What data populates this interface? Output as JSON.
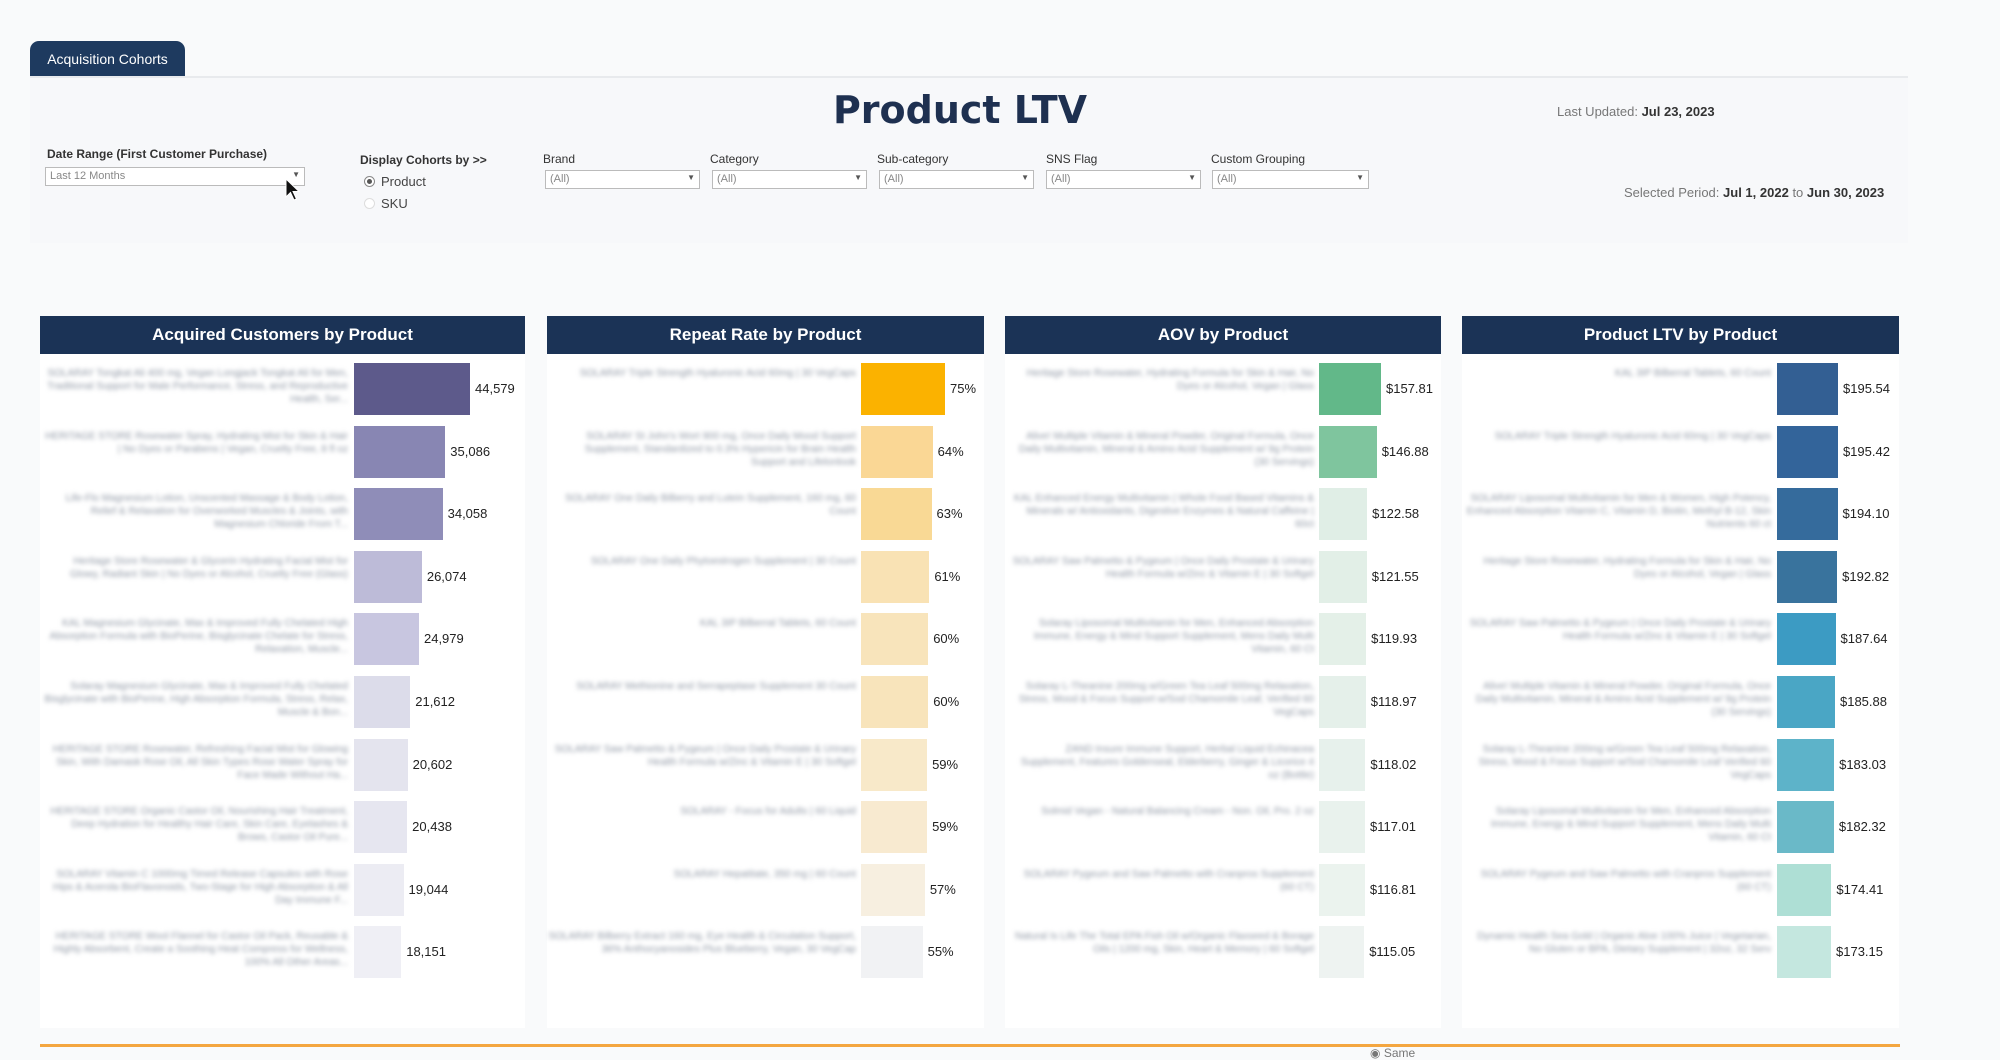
{
  "tab": {
    "label": "Acquisition Cohorts"
  },
  "header": {
    "title": "Product LTV",
    "last_updated_label": "Last Updated:",
    "last_updated_value": "Jul 23, 2023",
    "selected_period_label": "Selected Period:",
    "selected_period_start": "Jul 1, 2022",
    "selected_period_to": "to",
    "selected_period_end": "Jun 30, 2023"
  },
  "filters": {
    "date_range": {
      "label": "Date Range (First Customer Purchase)",
      "value": "Last 12 Months"
    },
    "display_cohorts": {
      "label": "Display Cohorts by >>",
      "options": [
        "Product",
        "SKU"
      ],
      "selected": "Product"
    },
    "brand": {
      "label": "Brand",
      "value": "(All)"
    },
    "category": {
      "label": "Category",
      "value": "(All)"
    },
    "subcategory": {
      "label": "Sub-category",
      "value": "(All)"
    },
    "sns_flag": {
      "label": "SNS Flag",
      "value": "(All)"
    },
    "custom_grouping": {
      "label": "Custom Grouping",
      "value": "(All)"
    }
  },
  "footer": {
    "same_label": "Same"
  },
  "chart_data": [
    {
      "type": "bar",
      "title": "Acquired Customers by Product",
      "categories": [
        "SOLARAY Tongkat Ali 400 mg, Vegan Longjack Tongkat Ali for Men, Traditional Support for Male Performance, Stress, and Reproductive Health, Ser...",
        "HERITAGE STORE Rosewater Spray, Hydrating Mist for Skin & Hair | No Dyes or Parabens | Vegan, Cruelty Free, 8 fl oz",
        "Life-Flo Magnesium Lotion, Unscented Massage & Body Lotion, Relief & Relaxation for Overworked Muscles & Joints, with Magnesium Chloride From T...",
        "Heritage Store Rosewater & Glycerin Hydrating Facial Mist for Glowy, Radiant Skin | No Dyes or Alcohol, Cruelty Free (Glass)",
        "KAL Magnesium Glycinate, Max & Improved Fully Chelated High Absorption Formula with BioPerine, Bisglycinate Chelate for Stress, Relaxation, Muscle...",
        "Solaray Magnesium Glycinate, Max & Improved Fully Chelated Bisglycinate with BioPerine, High Absorption Formula, Stress, Relax, Muscle & Bon...",
        "HERITAGE STORE Rosewater, Refreshing Facial Mist for Glowing Skin, With Damask Rose Oil, All Skin Types Rose Water Spray for Face Made Without Ha...",
        "HERITAGE STORE Organic Castor Oil, Nourishing Hair Treatment, Deep Hydration for Healthy Hair Care, Skin Care, Eyelashes & Brows, Castor Oil Pure...",
        "SOLARAY Vitamin C 1000mg Timed Release Capsules with Rose Hips & Acerola BioFlavonoids, Two-Stage for High Absorption & All Day Immune F...",
        "HERITAGE STORE Wool Flannel for Castor Oil Pack, Reusable & Highly Absorbent, Create a Soothing Heat Compress for Wellness, 100% All Other Areas..."
      ],
      "values": [
        44579,
        35086,
        34058,
        26074,
        24979,
        21612,
        20602,
        20438,
        19044,
        18151
      ],
      "labels": [
        "44,579",
        "35,086",
        "34,058",
        "26,074",
        "24,979",
        "21,612",
        "20,602",
        "20,438",
        "19,044",
        "18,151"
      ],
      "colors": [
        "#5d5a8b",
        "#8886b3",
        "#8f8db8",
        "#bdbbd8",
        "#c8c6e0",
        "#dcdcea",
        "#e4e4ee",
        "#e6e6f0",
        "#ececf3",
        "#efeff5"
      ],
      "xlim": [
        0,
        44579
      ]
    },
    {
      "type": "bar",
      "title": "Repeat Rate by Product",
      "categories": [
        "SOLARAY Triple Strength Hyaluronic Acid 60mg | 30 VegCaps",
        "SOLARAY St John's Wort 900 mg, Once Daily Mood Support Supplement, Standardized to 0.3% Hypericin for Brain Health Support and Lifelonlook",
        "SOLARAY One Daily Bilberry and Lutein Supplement, 160 mg, 60 Count",
        "SOLARAY One Daily Phytoestrogen Supplement | 30 Count",
        "KAL 3IP Bilberral Tablets, 60 Count",
        "SOLARAY Methionine and Serrapeptase Supplement 30 Count",
        "SOLARAY Saw Palmetto & Pygeum | Once Daily Prostate & Urinary Health Formula w/Zinc & Vitamin E | 30 Softgel",
        "SOLARAY - Focus for Adults | 60 Liquid",
        "SOLARAY Hepatitate, 350 mg | 60 Count",
        "SOLARAY Bilberry Extract 160 mg, Eye Health & Circulation Support, 36% Anthocyanosides Plus Blueberry, Vegan, 30 VegCap"
      ],
      "values": [
        75,
        64,
        63,
        61,
        60,
        60,
        59,
        59,
        57,
        55
      ],
      "labels": [
        "75%",
        "64%",
        "63%",
        "61%",
        "60%",
        "60%",
        "59%",
        "59%",
        "57%",
        "55%"
      ],
      "colors": [
        "#fbb200",
        "#fad795",
        "#f9d995",
        "#f9e2b4",
        "#f8e4bb",
        "#f8e4bb",
        "#f8e9c9",
        "#f8ead0",
        "#f7efe0",
        "#f1f2f4"
      ],
      "xlim": [
        0,
        75
      ]
    },
    {
      "type": "bar",
      "title": "AOV by Product",
      "categories": [
        "Heritage Store Rosewater, Hydrating Formula for Skin & Hair, No Dyes or Alcohol, Vegan | Glass",
        "Alive! Multiple Vitamin & Mineral Powder, Original Formula, Once Daily Multivitamin, Mineral & Amino Acid Supplement w/ 9g Protein (30 Servings)",
        "KAL Enhanced Energy Multivitamin | Whole Food Based Vitamins & Minerals w/ Antioxidants, Digestive Enzymes & Natural Caffeine | 60ct",
        "SOLARAY Saw Palmetto & Pygeum | Once Daily Prostate & Urinary Health Formula w/Zinc & Vitamin E | 30 Softgel",
        "Solaray Liposomal Multivitamin for Men, Enhanced Absorption Immune, Energy & Mind Support Supplement, Mens Daily Multi Vitamin, 60 Ct",
        "Solaray L-Theanine 200mg w/Green Tea Leaf 500mg Relaxation, Stress, Mood & Focus Support w/Sod Chamomile Leaf, Verified 60 VegCaps",
        "ZAND Insure Immune Support, Herbal Liquid Echinacea Supplement, Features Goldenseal, Elderberry, Ginger & Licorice 4 oz (Bottle)",
        "Solmid Vegan - Natural Balancing Cream - Non. Oil, Pro. 2 oz",
        "SOLARAY Pygeum and Saw Palmetto with Cranpros Supplement (60 CT)",
        "Natural Is Life The Total EPA Fish Oil w/Organic Flaxseed & Borage Oils | 1200 mg, Skin, Heart & Memory | 60 Softgel"
      ],
      "values": [
        157.81,
        146.88,
        122.58,
        121.55,
        119.93,
        118.97,
        118.02,
        117.01,
        116.81,
        115.05
      ],
      "labels": [
        "$157.81",
        "$146.88",
        "$122.58",
        "$121.55",
        "$119.93",
        "$118.97",
        "$118.02",
        "$117.01",
        "$116.81",
        "$115.05"
      ],
      "colors": [
        "#62b889",
        "#7fc59e",
        "#e0eee6",
        "#e2efe7",
        "#e4f0e8",
        "#e5f0ea",
        "#e7f1ec",
        "#e9f2ed",
        "#ebf3ee",
        "#eef3f1"
      ],
      "xlim": [
        0,
        157.81
      ]
    },
    {
      "type": "bar",
      "title": "Product LTV by Product",
      "categories": [
        "KAL 3IP Bilberral Tablets, 60 Count",
        "SOLARAY Triple Strength Hyaluronic Acid 60mg | 30 VegCaps",
        "SOLARAY Liposomal Multivitamin for Men & Women, High Potency, Enhanced Absorption Vitamin C, Vitamin D, Biotin, Methyl B-12, Skin Nutrients 60 ct",
        "Heritage Store Rosewater, Hydrating Formula for Skin & Hair, No Dyes or Alcohol, Vegan | Glass",
        "SOLARAY Saw Palmetto & Pygeum | Once Daily Prostate & Urinary Health Formula w/Zinc & Vitamin E | 30 Softgel",
        "Alive! Multiple Vitamin & Mineral Powder, Original Formula, Once Daily Multivitamin, Mineral & Amino Acid Supplement w/ 9g Protein (30 Servings)",
        "Solaray L-Theanine 200mg w/Green Tea Leaf 500mg Relaxation, Stress, Mood & Focus Support w/Sod Chamomile Leaf Verified 60 VegCaps",
        "Solaray Liposomal Multivitamin for Men, Enhanced Absorption Immune, Energy & Mind Support Supplement, Mens Daily Multi Vitamin, 60 Ct",
        "SOLARAY Pygeum and Saw Palmetto with Cranpros Supplement (60 CT)",
        "Dynamic Health Sea Gold | Organic Aloe 100% Juice | Vegetarian, No Gluten or BPA, Dietary Supplement | 32oz, 32 Serv"
      ],
      "values": [
        195.54,
        195.42,
        194.1,
        192.82,
        187.64,
        185.88,
        183.03,
        182.32,
        174.41,
        173.15
      ],
      "labels": [
        "$195.54",
        "$195.42",
        "$194.10",
        "$192.82",
        "$187.64",
        "$185.88",
        "$183.03",
        "$182.32",
        "$174.41",
        "$173.15"
      ],
      "colors": [
        "#335f93",
        "#33649a",
        "#356b9c",
        "#39739d",
        "#3c9bc3",
        "#4aa6c5",
        "#5db3c9",
        "#6ab9c8",
        "#aedfd5",
        "#c4e7df"
      ],
      "xlim": [
        0,
        195.54
      ]
    }
  ]
}
